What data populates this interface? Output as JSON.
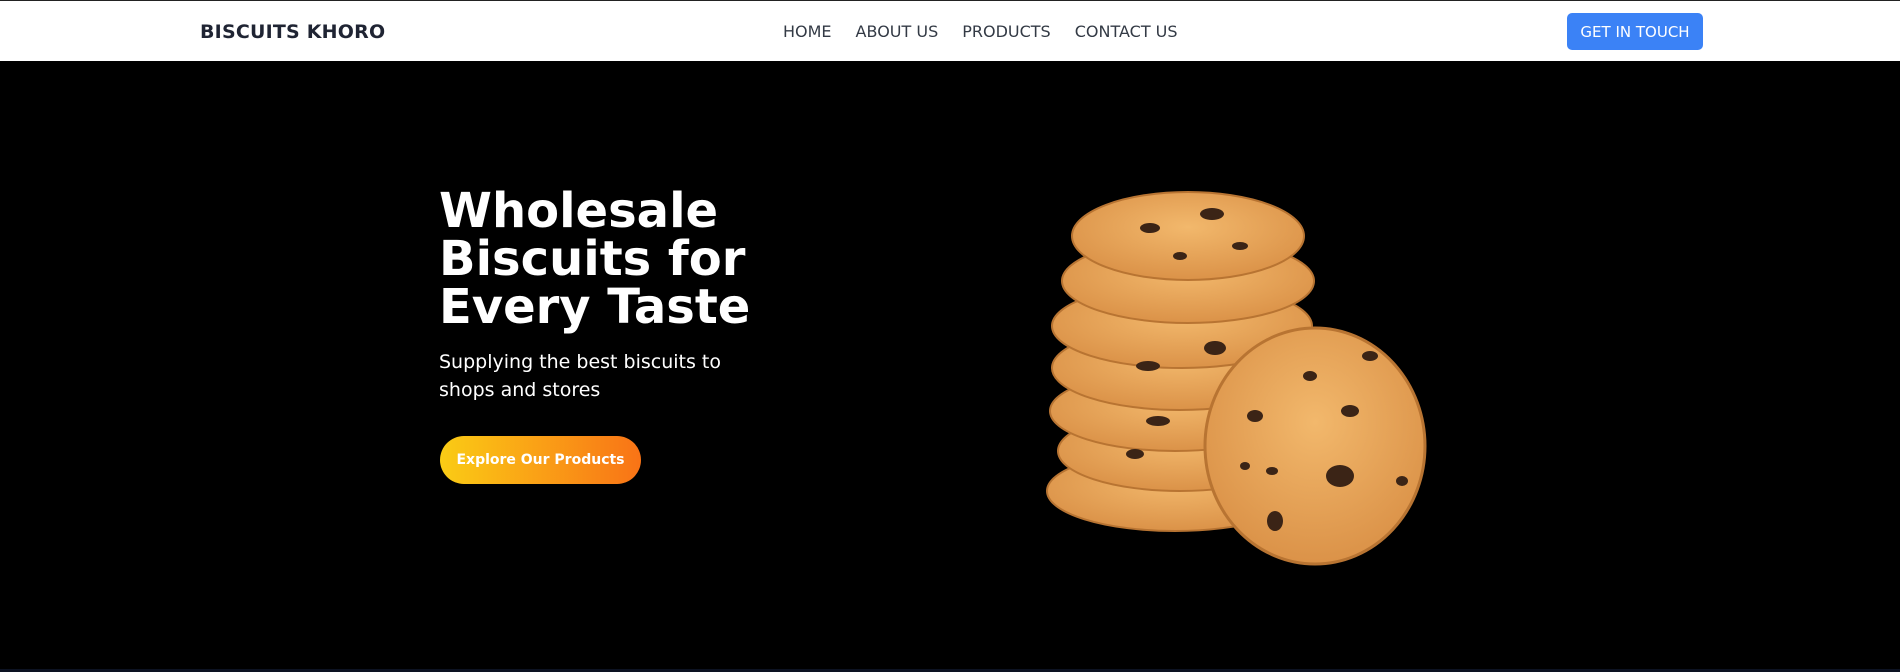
{
  "header": {
    "brand": "BISCUITS KHORO",
    "nav": [
      {
        "label": "HOME"
      },
      {
        "label": "ABOUT US"
      },
      {
        "label": "PRODUCTS"
      },
      {
        "label": "CONTACT US"
      }
    ],
    "cta_label": "GET IN TOUCH"
  },
  "hero": {
    "title": "Wholesale Biscuits for Every Taste",
    "subtitle": "Supplying the best biscuits to shops and stores",
    "button_label": "Explore Our Products",
    "image_icon": "chocolate-chip-cookies-stack"
  },
  "colors": {
    "accent": "#3b82f6",
    "gradient_start": "#facc15",
    "gradient_end": "#f97316",
    "hero_bg": "#000000",
    "cookie": "#e8a65c"
  }
}
